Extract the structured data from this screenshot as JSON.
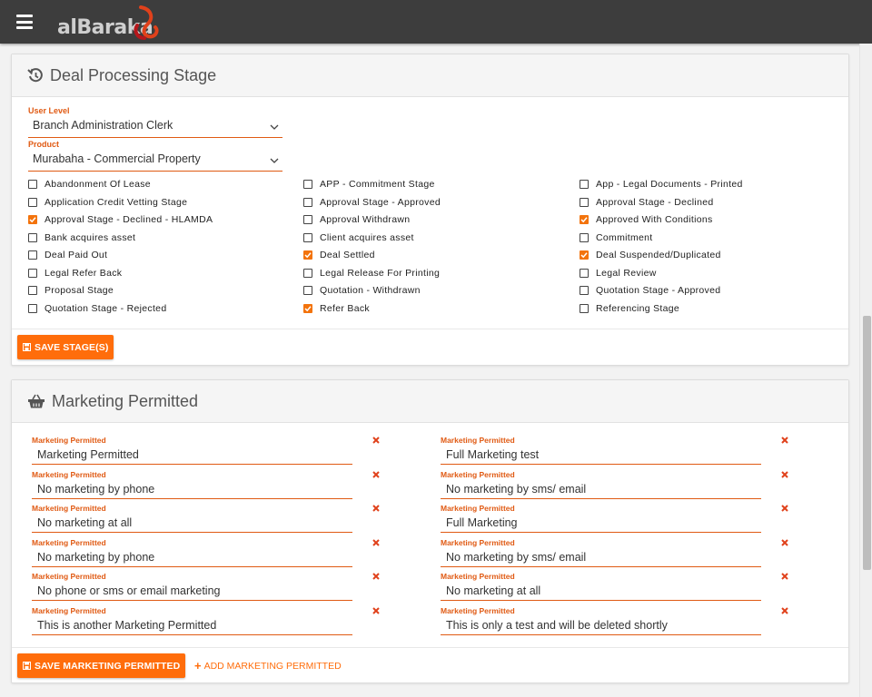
{
  "header": {
    "logo_text": "alBaraka",
    "menu_icon": "hamburger-menu-icon",
    "colors": {
      "bar": "#3d3d3d",
      "accent": "#ff6d0b"
    }
  },
  "deal": {
    "title": "Deal Processing Stage",
    "icon": "history-icon",
    "user_level": {
      "label": "User Level",
      "value": "Branch Administration Clerk"
    },
    "product": {
      "label": "Product",
      "value": "Murabaha - Commercial Property"
    },
    "stages": [
      {
        "label": "Abandonment Of Lease",
        "checked": false
      },
      {
        "label": "APP - Commitment Stage",
        "checked": false
      },
      {
        "label": "App - Legal Documents - Printed",
        "checked": false
      },
      {
        "label": "Application Credit Vetting Stage",
        "checked": false
      },
      {
        "label": "Approval Stage - Approved",
        "checked": false
      },
      {
        "label": "Approval Stage - Declined",
        "checked": false
      },
      {
        "label": "Approval Stage - Declined - HLAMDA",
        "checked": true
      },
      {
        "label": "Approval Withdrawn",
        "checked": false
      },
      {
        "label": "Approved With Conditions",
        "checked": true
      },
      {
        "label": "Bank acquires asset",
        "checked": false
      },
      {
        "label": "Client acquires asset",
        "checked": false
      },
      {
        "label": "Commitment",
        "checked": false
      },
      {
        "label": "Deal Paid Out",
        "checked": false
      },
      {
        "label": "Deal Settled",
        "checked": true
      },
      {
        "label": "Deal Suspended/Duplicated",
        "checked": true
      },
      {
        "label": "Legal Refer Back",
        "checked": false
      },
      {
        "label": "Legal Release For Printing",
        "checked": false
      },
      {
        "label": "Legal Review",
        "checked": false
      },
      {
        "label": "Proposal Stage",
        "checked": false
      },
      {
        "label": "Quotation - Withdrawn",
        "checked": false
      },
      {
        "label": "Quotation Stage - Approved",
        "checked": false
      },
      {
        "label": "Quotation Stage - Rejected",
        "checked": false
      },
      {
        "label": "Refer Back",
        "checked": true
      },
      {
        "label": "Referencing Stage",
        "checked": false
      }
    ],
    "save_label": "SAVE STAGE(S)"
  },
  "marketing": {
    "title": "Marketing Permitted",
    "icon": "basket-icon",
    "field_label": "Marketing Permitted",
    "items": [
      "Marketing Permitted",
      "Full Marketing test",
      "No marketing by phone",
      "No marketing by sms/ email",
      "No marketing at all",
      "Full Marketing",
      "No marketing by phone",
      "No marketing by sms/ email",
      "No phone or sms or email marketing",
      "No marketing at all",
      "This is another Marketing Permitted",
      "This is only a test and will be deleted shortly"
    ],
    "save_label": "SAVE MARKETING PERMITTED",
    "add_label": "ADD MARKETING PERMITTED"
  }
}
